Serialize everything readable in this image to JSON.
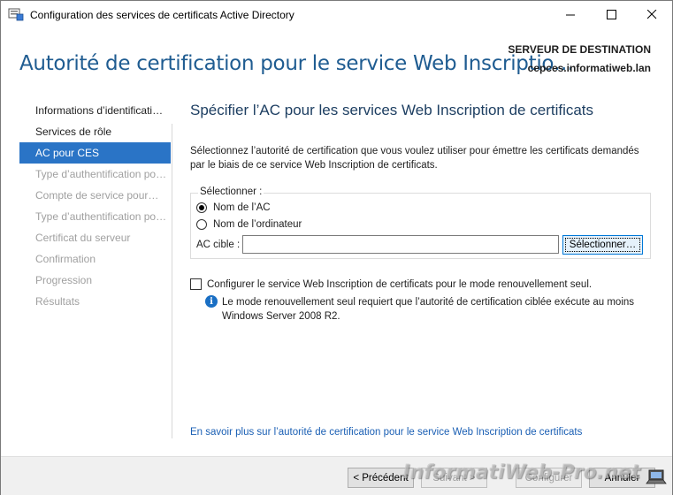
{
  "window": {
    "title": "Configuration des services de certificats Active Directory",
    "icons": {
      "app": "server-manager-icon",
      "minimize": "minimize-icon",
      "maximize": "maximize-icon",
      "close": "close-icon"
    }
  },
  "header": {
    "wizard_title": "Autorité de certification pour le service Web Inscriptio…",
    "dest_label": "SERVEUR DE DESTINATION",
    "dest_server": "cepces.informatiweb.lan"
  },
  "nav": {
    "items": [
      {
        "label": "Informations d’identificati…",
        "state": "normal"
      },
      {
        "label": "Services de rôle",
        "state": "normal"
      },
      {
        "label": "AC pour CES",
        "state": "active"
      },
      {
        "label": "Type d’authentification po…",
        "state": "disabled"
      },
      {
        "label": "Compte de service pour…",
        "state": "disabled"
      },
      {
        "label": "Type d’authentification po…",
        "state": "disabled"
      },
      {
        "label": "Certificat du serveur",
        "state": "disabled"
      },
      {
        "label": "Confirmation",
        "state": "disabled"
      },
      {
        "label": "Progression",
        "state": "disabled"
      },
      {
        "label": "Résultats",
        "state": "disabled"
      }
    ]
  },
  "main": {
    "heading": "Spécifier l’AC pour les services Web Inscription de certificats",
    "description": "Sélectionnez l’autorité de certification que vous voulez utiliser pour émettre les certificats demandés par le biais de ce service Web Inscription de certificats.",
    "select_group": {
      "legend": "Sélectionner :",
      "option_ca_name": "Nom de l’AC",
      "option_computer_name": "Nom de l’ordinateur",
      "selected_option": "Nom de l’AC",
      "target_label": "AC cible :",
      "target_value": "",
      "select_button": "Sélectionner…"
    },
    "renewal_checkbox_label": "Configurer le service Web Inscription de certificats pour le mode renouvellement seul.",
    "renewal_checked": false,
    "info_text": "Le mode renouvellement seul requiert que l’autorité de certification ciblée exécute au moins Windows Server 2008 R2.",
    "help_link": "En savoir plus sur l’autorité de certification pour le service Web Inscription de certificats"
  },
  "footer": {
    "previous": "< Précédent",
    "next": "Suivant >",
    "configure": "Configurer",
    "cancel": "Annuler"
  },
  "watermark": "InformatiWeb-Pro.net",
  "colors": {
    "accent": "#2a74c6",
    "title": "#1f5c91",
    "link": "#1a5fb4"
  }
}
